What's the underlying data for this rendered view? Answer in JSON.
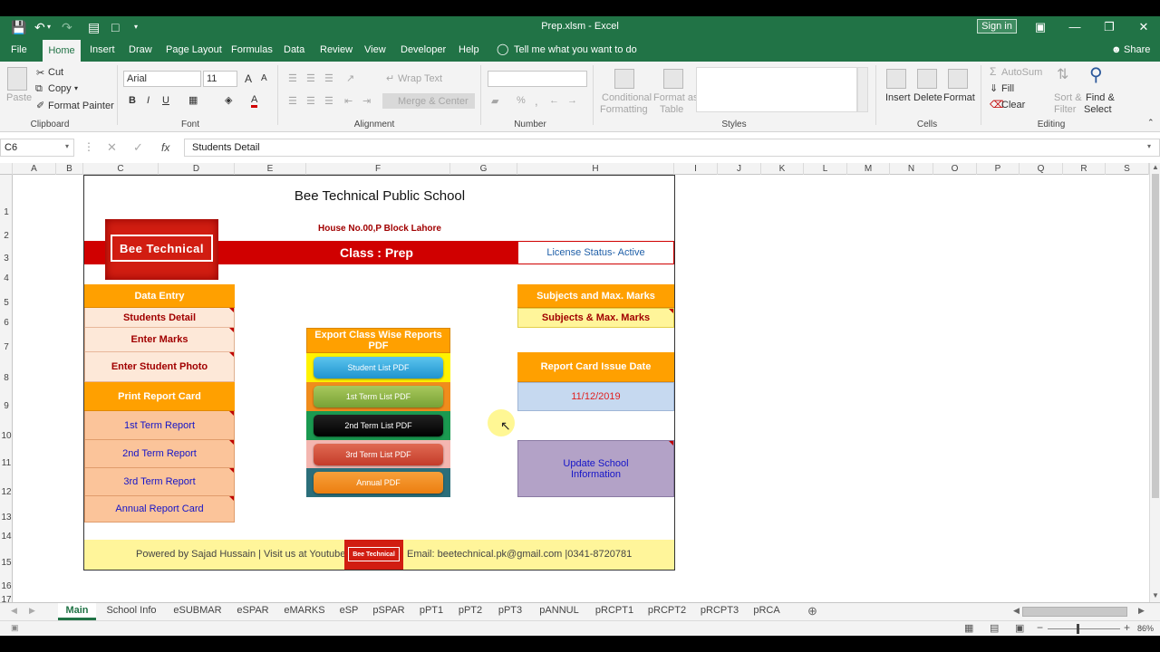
{
  "app": {
    "title": "Prep.xlsm  -  Excel",
    "sign_in": "Sign in",
    "share": "Share"
  },
  "menu": {
    "tabs": [
      "File",
      "Home",
      "Insert",
      "Draw",
      "Page Layout",
      "Formulas",
      "Data",
      "Review",
      "View",
      "Developer",
      "Help"
    ],
    "tell_me": "Tell me what you want to do"
  },
  "ribbon": {
    "clipboard": {
      "paste": "Paste",
      "cut": "Cut",
      "copy": "Copy",
      "format_painter": "Format Painter",
      "label": "Clipboard"
    },
    "font": {
      "name": "Arial",
      "size": "11",
      "bold": "B",
      "italic": "I",
      "underline": "U",
      "grow": "A",
      "shrink": "A",
      "color": "A",
      "label": "Font"
    },
    "alignment": {
      "wrap": "Wrap Text",
      "merge": "Merge & Center",
      "label": "Alignment"
    },
    "number": {
      "percent": "%",
      "comma": ",",
      "label": "Number"
    },
    "styles": {
      "conditional": "Conditional",
      "formatting": "Formatting",
      "format_as": "Format as",
      "table": "Table",
      "label": "Styles"
    },
    "cells": {
      "insert": "Insert",
      "delete": "Delete",
      "format": "Format",
      "label": "Cells"
    },
    "editing": {
      "autosum": "AutoSum",
      "fill": "Fill",
      "clear": "Clear",
      "sort": "Sort &",
      "filter": "Filter",
      "find": "Find &",
      "select": "Select",
      "label": "Editing"
    }
  },
  "formula_bar": {
    "name_box": "C6",
    "fx": "fx",
    "content": "Students Detail"
  },
  "columns": [
    "A",
    "B",
    "C",
    "D",
    "E",
    "F",
    "G",
    "H",
    "I",
    "J",
    "K",
    "L",
    "M",
    "N",
    "O",
    "P",
    "Q",
    "R",
    "S"
  ],
  "rows": [
    "1",
    "2",
    "3",
    "4",
    "5",
    "6",
    "7",
    "8",
    "9",
    "10",
    "11",
    "12",
    "13",
    "14",
    "15",
    "16",
    "17"
  ],
  "sheet": {
    "school_name": "Bee Technical Public School",
    "address": "House No.00,P Block Lahore",
    "logo_text": "Bee Technical",
    "class_label": "Class : Prep",
    "license": "License Status- Active",
    "data_entry": "Data Entry",
    "students_detail": "Students Detail",
    "enter_marks": "Enter Marks",
    "enter_photo": "Enter Student Photo",
    "print_report": "Print Report Card",
    "term1": "1st Term Report",
    "term2": "2nd Term Report",
    "term3": "3rd Term Report",
    "annual": "Annual Report Card",
    "export_header": "Export Class Wise Reports PDF",
    "pdf_student": "Student List PDF",
    "pdf_term1": "1st Term List PDF",
    "pdf_term2": "2nd Term List PDF",
    "pdf_term3": "3rd Term List PDF",
    "pdf_annual": "Annual PDF",
    "subjects_header": "Subjects and Max. Marks",
    "subjects_btn": "Subjects & Max. Marks",
    "issue_date_header": "Report Card Issue Date",
    "issue_date": "11/12/2019",
    "update_school": "Update School Information",
    "footer_left": "Powered by Sajad Hussain | Visit us at Youtube :",
    "footer_logo": "Bee Technical",
    "footer_right": "Email: beetechnical.pk@gmail.com |0341-8720781"
  },
  "sheet_tabs": [
    "Main",
    "School Info",
    "eSUBMAR",
    "eSPAR",
    "eMARKS",
    "eSP",
    "pSPAR",
    "pPT1",
    "pPT2",
    "pPT3",
    "pANNUL",
    "pRCPT1",
    "pRCPT2",
    "pRCPT3",
    "pRCA"
  ],
  "status": {
    "zoom": "86%"
  },
  "colors": {
    "excel_green": "#217346",
    "orange": "#ffa000",
    "red_band": "#d00000"
  }
}
